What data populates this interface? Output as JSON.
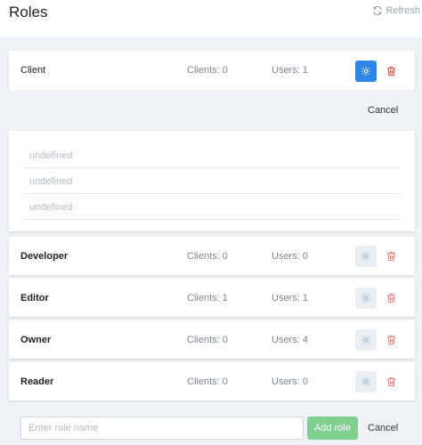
{
  "header": {
    "title": "Roles",
    "refresh_label": "Refresh"
  },
  "roles": [
    {
      "name": "Client",
      "clients": "Clients: 0",
      "users": "Users: 1",
      "expanded": true
    },
    {
      "name": "Developer",
      "clients": "Clients: 0",
      "users": "Users: 0",
      "expanded": false
    },
    {
      "name": "Editor",
      "clients": "Clients: 1",
      "users": "Users: 1",
      "expanded": false
    },
    {
      "name": "Owner",
      "clients": "Clients: 0",
      "users": "Users: 4",
      "expanded": false
    },
    {
      "name": "Reader",
      "clients": "Clients: 0",
      "users": "Users: 0",
      "expanded": false
    }
  ],
  "expanded_panel": {
    "cancel_label": "Cancel",
    "fields": [
      "undefined",
      "undefined",
      "undefined"
    ]
  },
  "add_role": {
    "placeholder": "Enter role name",
    "add_label": "Add role",
    "cancel_label": "Cancel"
  },
  "colors": {
    "primary": "#2f86e8",
    "success": "#7fcf8f",
    "danger": "#e05a5a",
    "panel_bg": "#eef2f5"
  },
  "icons": {
    "refresh": "refresh-icon",
    "settings": "gear-icon",
    "delete": "trash-icon"
  }
}
